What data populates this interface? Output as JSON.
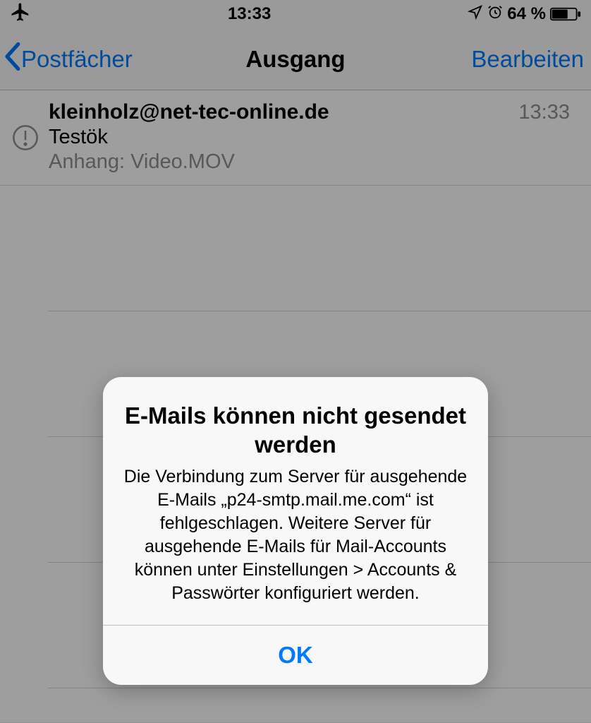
{
  "statusbar": {
    "time": "13:33",
    "battery": "64 %"
  },
  "nav": {
    "back": "Postfächer",
    "title": "Ausgang",
    "edit": "Bearbeiten"
  },
  "mail": {
    "sender": "kleinholz@net-tec-online.de",
    "time": "13:33",
    "subject": "Testök",
    "attachment": "Anhang: Video.MOV"
  },
  "alert": {
    "title": "E-Mails können nicht gesendet werden",
    "message": "Die Verbindung zum Server für ausgehende E-Mails „p24-smtp.mail.me.com“ ist fehlgeschlagen. Weitere Server für ausgehende E-Mails für Mail-Accounts können unter Einstellungen > Accounts & Passwörter konfiguriert werden.",
    "ok": "OK"
  }
}
